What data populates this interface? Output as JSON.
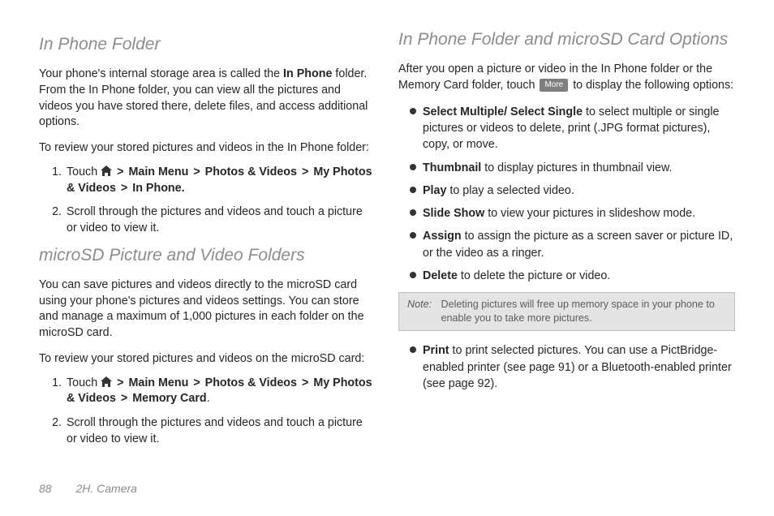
{
  "col1": {
    "h1": "In Phone Folder",
    "p1a": "Your phone's internal storage area is called the ",
    "p1b": "In Phone",
    "p1c": " folder. From the In Phone folder, you can view all the pictures and videos you have stored there, delete files, and access additional options.",
    "lead1": "To review your stored pictures and videos in the In Phone folder:",
    "s1": {
      "i1pre": "Touch ",
      "gt": ">",
      "m1": "Main Menu",
      "m2": "Photos & Videos",
      "m3": "My Photos & Videos",
      "m4": "In Phone.",
      "i2": "Scroll through the pictures and videos and touch a picture or video to view it."
    },
    "h2": "microSD Picture and Video Folders",
    "p2": "You can save pictures and videos directly to the microSD card using your phone's pictures and videos settings. You can store and manage a maximum of 1,000 pictures in each folder on the microSD card.",
    "lead2": "To review your stored pictures and videos on the microSD card:",
    "s2": {
      "i1pre": "Touch ",
      "m4": "Memory Card",
      "dot": "."
    }
  },
  "col2": {
    "s3": {
      "i2": "Scroll through the pictures and videos and touch a picture or video to view it."
    },
    "h3": "In Phone Folder and microSD Card Options",
    "p3a": "After you open a picture or video in the In Phone folder or the Memory Card folder, touch ",
    "more": "More",
    "p3b": " to display the following options:",
    "bul": {
      "b1a": "Select Multiple/ Select Single",
      "b1b": " to select multiple or single pictures or videos to delete, print (.JPG format pictures), copy, or move.",
      "b2a": "Thumbnail",
      "b2b": " to display pictures in thumbnail view.",
      "b3a": "Play",
      "b3b": " to play a selected video.",
      "b4a": "Slide Show",
      "b4b": " to view your pictures in slideshow mode.",
      "b5a": "Assign",
      "b5b": " to assign the picture as a screen saver or picture ID, or the video as a ringer.",
      "b6a": "Delete",
      "b6b": " to delete the picture or video.",
      "b7a": "Print",
      "b7b": " to print selected pictures. You can use a PictBridge-enabled printer (see page 91) or a Bluetooth-enabled printer (see page 92)."
    },
    "note": {
      "label": "Note:",
      "body": "Deleting pictures will free up memory space in your phone to enable you to take more pictures."
    }
  },
  "footer": {
    "page": "88",
    "section": "2H. Camera"
  }
}
